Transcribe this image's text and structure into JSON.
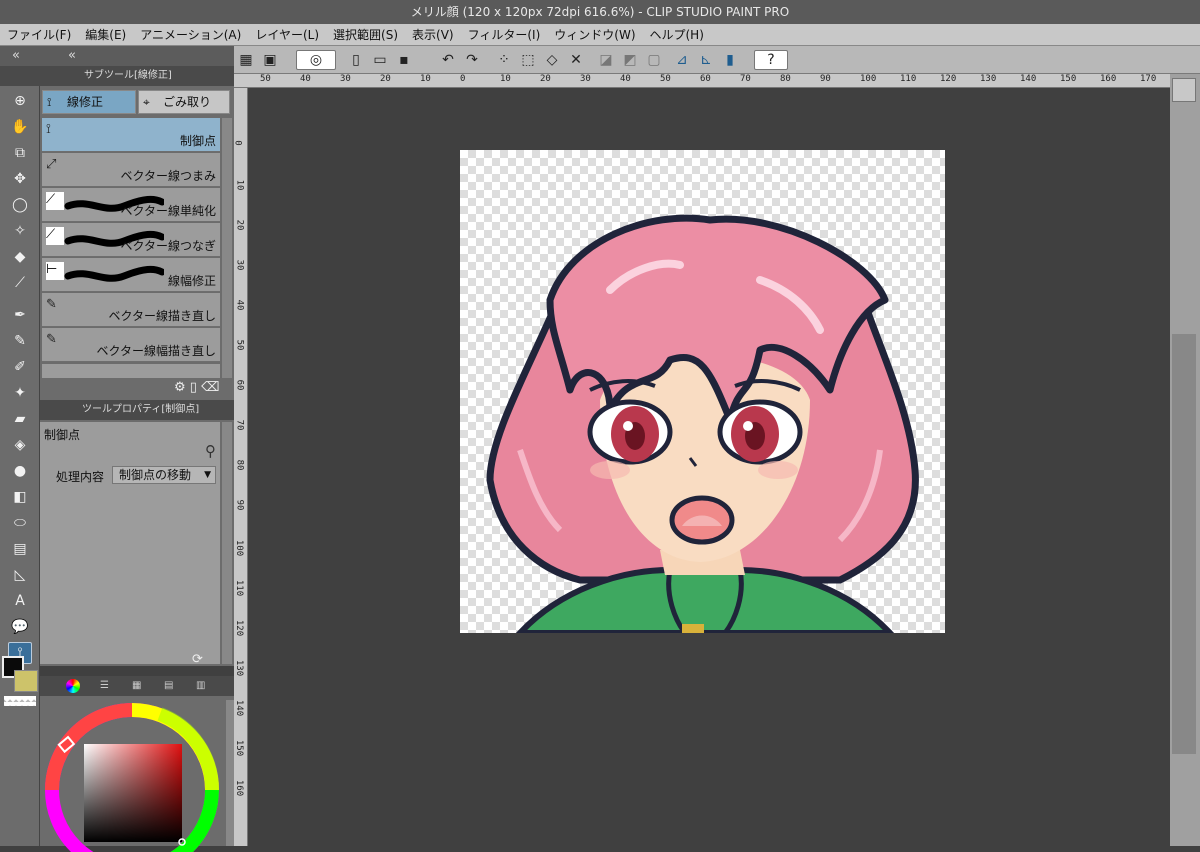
{
  "window": {
    "title": "メリル顔 (120 x 120px 72dpi 616.6%)  - CLIP STUDIO PAINT PRO"
  },
  "menu": [
    "ファイル(F)",
    "編集(E)",
    "アニメーション(A)",
    "レイヤー(L)",
    "選択範囲(S)",
    "表示(V)",
    "フィルター(I)",
    "ウィンドウ(W)",
    "ヘルプ(H)"
  ],
  "left_strip": {
    "collapse_a": "«",
    "collapse_b": "«"
  },
  "subtool": {
    "header": "サブツール[線修正]",
    "tabs": [
      "線修正",
      "ごみ取り"
    ],
    "items": [
      "制御点",
      "ベクター線つまみ",
      "ベクター線単純化",
      "ベクター線つなぎ",
      "線幅修正",
      "ベクター線描き直し",
      "ベクター線幅描き直し"
    ]
  },
  "toolprop": {
    "header": "ツールプロパティ[制御点]",
    "name": "制御点",
    "field_label": "処理内容",
    "field_value": "制御点の移動"
  },
  "ruler": {
    "h": [
      "50",
      "40",
      "30",
      "20",
      "10",
      "0",
      "10",
      "20",
      "30",
      "40",
      "50",
      "60",
      "70",
      "80",
      "90",
      "100",
      "110",
      "120",
      "130",
      "140",
      "150",
      "160",
      "170"
    ],
    "v": [
      "0",
      "10",
      "20",
      "30",
      "40",
      "50",
      "60",
      "70",
      "80",
      "90",
      "100",
      "110",
      "120",
      "130",
      "140",
      "150",
      "160"
    ]
  },
  "colors": {
    "main": "#0a0a0a",
    "sub": "#cdc36a",
    "accent": "#3a6f9a"
  },
  "icons": [
    "hand-icon",
    "zoom-icon",
    "move-icon",
    "lasso-icon",
    "eyedropper-icon",
    "pen-icon",
    "pencil-icon",
    "brush-icon",
    "airbrush-icon",
    "eraser-icon",
    "fill-icon",
    "gradient-icon",
    "shape-icon",
    "frame-icon",
    "ruler-icon",
    "text-icon",
    "balloon-icon",
    "correct-line-icon"
  ]
}
